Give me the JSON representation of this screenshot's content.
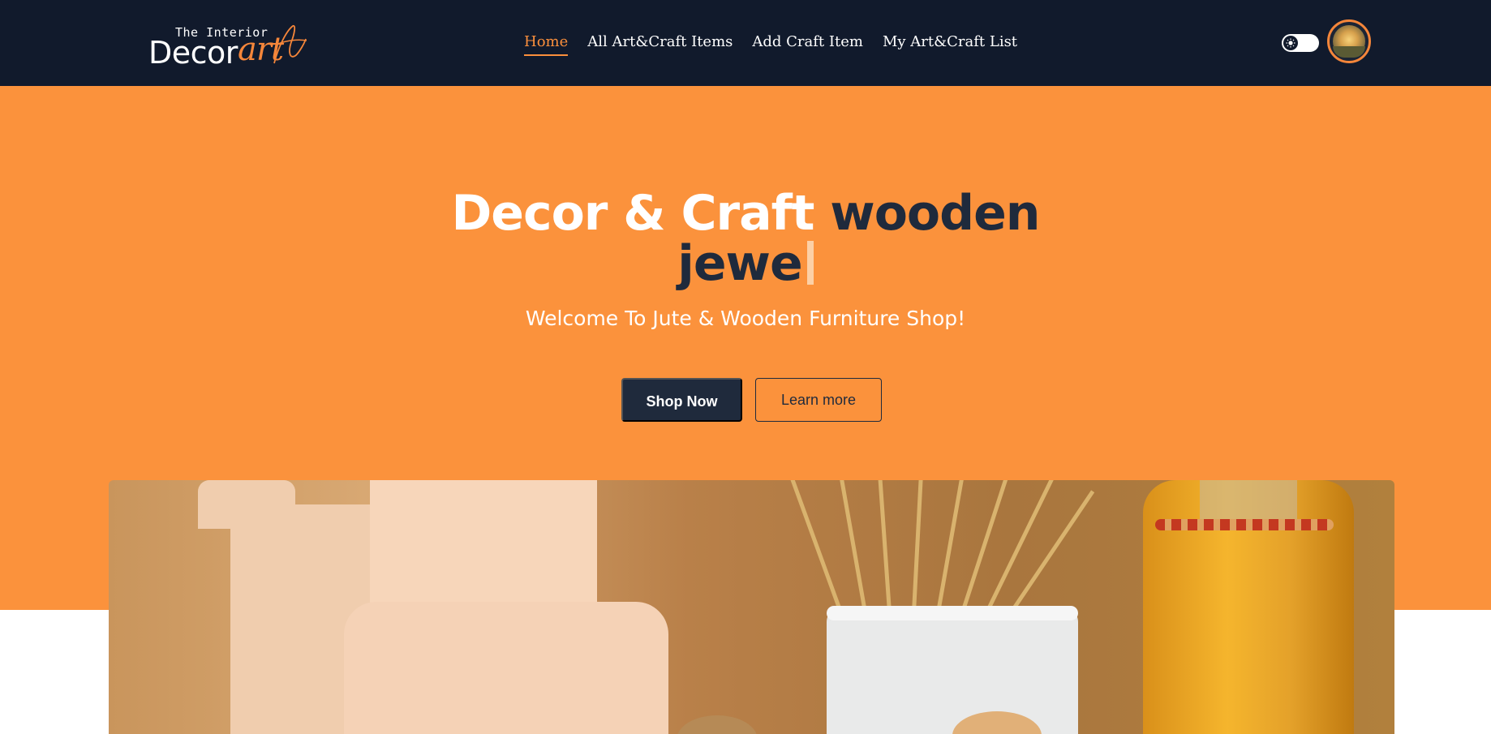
{
  "brand": {
    "tagline": "The Interior",
    "name": "Decor",
    "script": "art"
  },
  "nav": {
    "items": [
      {
        "label": "Home",
        "active": true
      },
      {
        "label": "All Art&Craft Items",
        "active": false
      },
      {
        "label": "Add Craft Item",
        "active": false
      },
      {
        "label": "My Art&Craft List",
        "active": false
      }
    ]
  },
  "header_controls": {
    "theme_toggle_icon": "sun-icon",
    "avatar_icon": "user-avatar"
  },
  "hero": {
    "title_static": "Decor & Craft",
    "title_typed_line1": "wooden",
    "title_typed_line2": "jewe",
    "subtitle": "Welcome To Jute & Wooden Furniture Shop!",
    "primary_button": "Shop Now",
    "secondary_button": "Learn more"
  },
  "colors": {
    "navbar_bg": "#111a2c",
    "accent": "#fb923c",
    "active_link": "#fb8f3c",
    "dark_text": "#1f2a3c"
  }
}
